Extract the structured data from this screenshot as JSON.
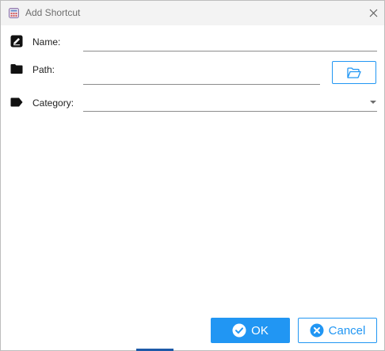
{
  "window": {
    "title": "Add Shortcut",
    "close_icon": "close-icon",
    "app_icon": "calculator-app-icon"
  },
  "form": {
    "name": {
      "icon": "edit-icon",
      "label": "Name:",
      "value": ""
    },
    "path": {
      "icon": "folder-icon",
      "label": "Path:",
      "value": "",
      "browse_icon": "folder-open-icon"
    },
    "category": {
      "icon": "tag-icon",
      "label": "Category:",
      "value": ""
    }
  },
  "actions": {
    "ok_label": "OK",
    "cancel_label": "Cancel"
  },
  "colors": {
    "accent": "#2196f3",
    "text": "#222222",
    "title_text": "#6e6e6e"
  }
}
